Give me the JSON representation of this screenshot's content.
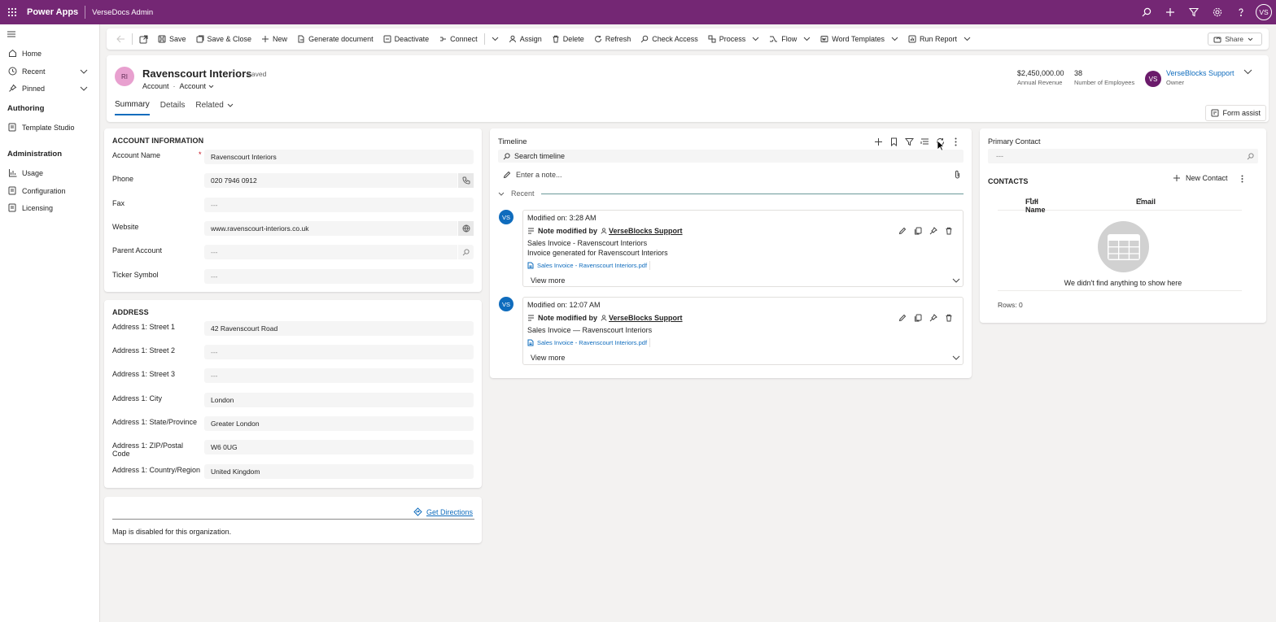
{
  "topbar": {
    "app": "Power Apps",
    "environment": "VerseDocs Admin",
    "avatar": "VS"
  },
  "sidebar": {
    "items": [
      {
        "label": "Home"
      },
      {
        "label": "Recent"
      },
      {
        "label": "Pinned"
      }
    ],
    "groups": [
      {
        "title": "Authoring",
        "items": [
          {
            "label": "Template Studio"
          }
        ]
      },
      {
        "title": "Administration",
        "items": [
          {
            "label": "Usage"
          },
          {
            "label": "Configuration"
          },
          {
            "label": "Licensing"
          }
        ]
      }
    ]
  },
  "commandbar": {
    "save": "Save",
    "save_close": "Save & Close",
    "new": "New",
    "generate": "Generate document",
    "deactivate": "Deactivate",
    "connect": "Connect",
    "assign": "Assign",
    "delete": "Delete",
    "refresh": "Refresh",
    "check_access": "Check Access",
    "process": "Process",
    "flow": "Flow",
    "word_templates": "Word Templates",
    "run_report": "Run Report",
    "share": "Share"
  },
  "record": {
    "initials": "RI",
    "name": "Ravenscourt Interiors",
    "saved": "- Saved",
    "entity": "Account",
    "form": "Account",
    "annual_revenue": "$2,450,000.00",
    "annual_revenue_label": "Annual Revenue",
    "employees": "38",
    "employees_label": "Number of Employees",
    "owner_initials": "VS",
    "owner": "VerseBlocks Support",
    "owner_label": "Owner",
    "tabs": [
      "Summary",
      "Details",
      "Related"
    ],
    "form_assist": "Form assist"
  },
  "account_info": {
    "title": "ACCOUNT INFORMATION",
    "account_name_label": "Account Name",
    "account_name": "Ravenscourt Interiors",
    "phone_label": "Phone",
    "phone": "020 7946 0912",
    "fax_label": "Fax",
    "fax": "---",
    "website_label": "Website",
    "website": "www.ravenscourt-interiors.co.uk",
    "parent_label": "Parent Account",
    "parent": "---",
    "ticker_label": "Ticker Symbol",
    "ticker": "---"
  },
  "address": {
    "title": "ADDRESS",
    "street1_label": "Address 1: Street 1",
    "street1": "42 Ravenscourt Road",
    "street2_label": "Address 1: Street 2",
    "street2": "---",
    "street3_label": "Address 1: Street 3",
    "street3": "---",
    "city_label": "Address 1: City",
    "city": "London",
    "state_label": "Address 1: State/Province",
    "state": "Greater London",
    "zip_label": "Address 1: ZIP/Postal Code",
    "zip": "W6 0UG",
    "country_label": "Address 1: Country/Region",
    "country": "United Kingdom"
  },
  "map": {
    "directions": "Get Directions",
    "message": "Map is disabled for this organization."
  },
  "timeline": {
    "title": "Timeline",
    "search_placeholder": "Search timeline",
    "note_placeholder": "Enter a note...",
    "recent": "Recent",
    "entries": [
      {
        "avatar": "VS",
        "modified": "Modified on: 3:28 AM",
        "kind": "Note modified by",
        "user": "VerseBlocks Support",
        "line1": "Sales Invoice - Ravenscourt Interiors",
        "line2": "Invoice generated for Ravenscourt Interiors",
        "attachment": "Sales Invoice - Ravenscourt Interiors.pdf",
        "view_more": "View more"
      },
      {
        "avatar": "VS",
        "modified": "Modified on: 12:07 AM",
        "kind": "Note modified by",
        "user": "VerseBlocks Support",
        "line1": "Sales Invoice — Ravenscourt Interiors",
        "line2": "",
        "attachment": "Sales Invoice - Ravenscourt Interiors.pdf",
        "view_more": "View more"
      }
    ]
  },
  "contacts": {
    "primary_label": "Primary Contact",
    "primary_value": "---",
    "title": "CONTACTS",
    "new": "New Contact",
    "col_fullname": "Full Name",
    "col_email": "Email",
    "empty": "We didn't find anything to show here",
    "rows": "Rows: 0"
  }
}
